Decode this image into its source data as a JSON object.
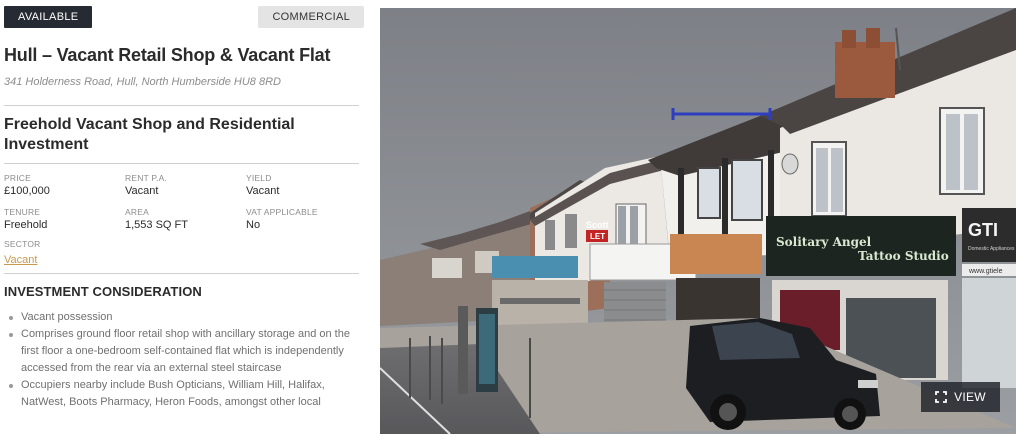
{
  "badges": {
    "status": "AVAILABLE",
    "type": "COMMERCIAL"
  },
  "listing": {
    "title": "Hull – Vacant Retail Shop & Vacant Flat",
    "address": "341 Holderness Road, Hull, North Humberside HU8 8RD",
    "subtitle": "Freehold Vacant Shop and Residential Investment"
  },
  "facts": {
    "price_label": "PRICE",
    "price": "£100,000",
    "rent_label": "RENT P.A.",
    "rent": "Vacant",
    "yield_label": "YIELD",
    "yield": "Vacant",
    "tenure_label": "TENURE",
    "tenure": "Freehold",
    "area_label": "AREA",
    "area": "1,553 SQ FT",
    "vat_label": "VAT APPLICABLE",
    "vat": "No",
    "sector_label": "SECTOR",
    "sector": "Vacant"
  },
  "investment": {
    "heading": "INVESTMENT CONSIDERATION",
    "bullets": [
      "Vacant possession",
      "Comprises ground floor retail shop with ancillary storage and on the first floor a one-bedroom self-contained flat which is independently accessed from the rear via an external steel staircase",
      "Occupiers nearby include Bush Opticians, William Hill, Halifax, NatWest, Boots Pharmacy, Heron Foods, amongst other local"
    ]
  },
  "photo": {
    "view_label": "VIEW",
    "view_icon": "expand-icon",
    "signs": [
      "Scott",
      "LET",
      "Solitary Angel",
      "Tattoo Studio",
      "GTI",
      "Domestic Appliances",
      "www.gtiele"
    ]
  }
}
